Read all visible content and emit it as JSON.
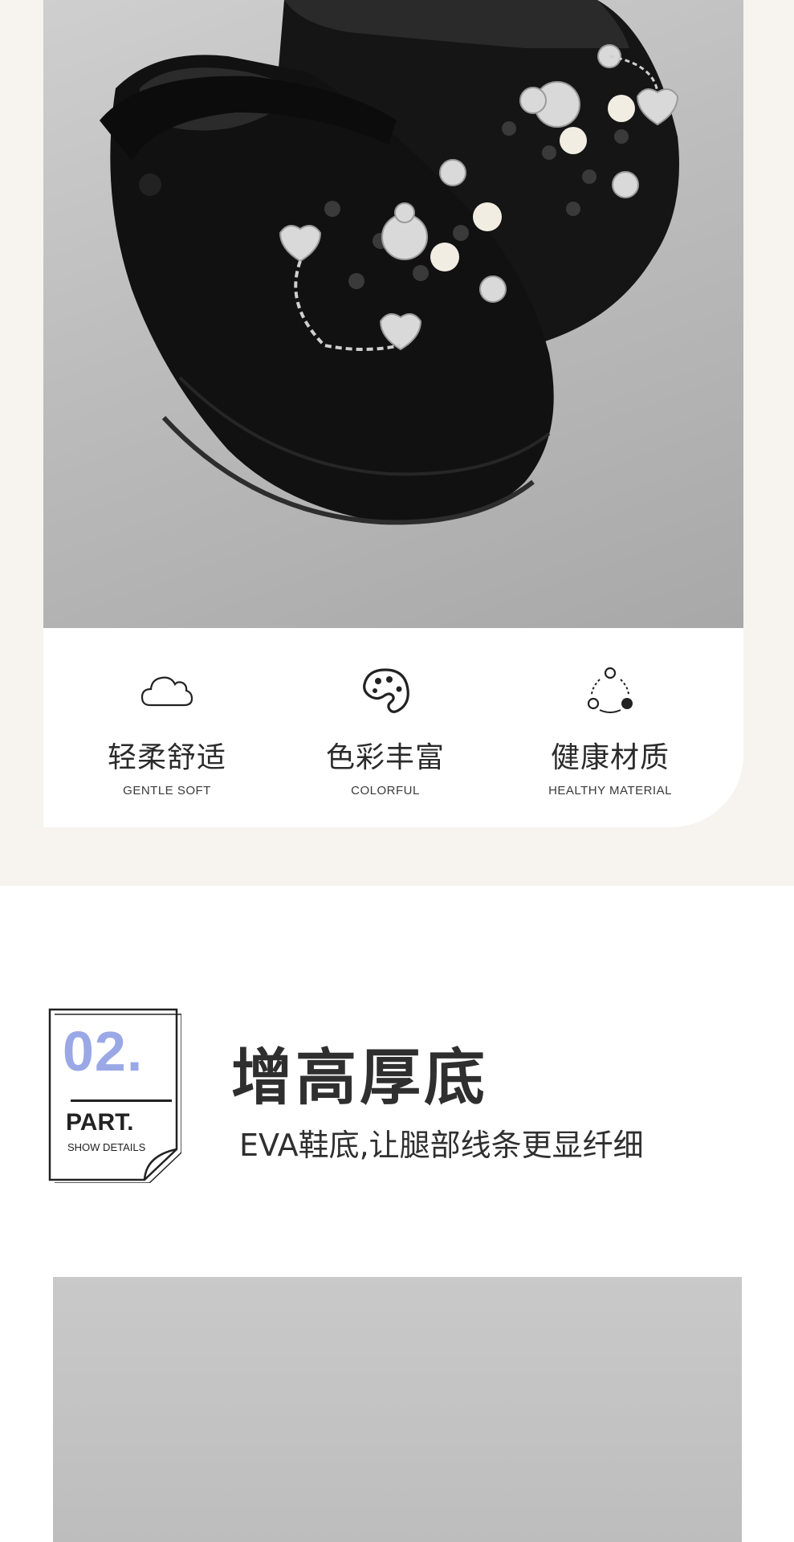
{
  "features": [
    {
      "icon": "cloud-icon",
      "title": "轻柔舒适",
      "subtitle": "GENTLE SOFT"
    },
    {
      "icon": "palette-icon",
      "title": "色彩丰富",
      "subtitle": "COLORFUL"
    },
    {
      "icon": "cycle-icon",
      "title": "健康材质",
      "subtitle": "HEALTHY MATERIAL"
    }
  ],
  "part": {
    "number": "02.",
    "label": "PART.",
    "detail": "SHOW DETAILS"
  },
  "section": {
    "title": "增高厚底",
    "subtitle": "EVA鞋底,让腿部线条更显纤细"
  },
  "colors": {
    "accent": "#9aa8e6",
    "text": "#2b2b2b",
    "page_bg": "#f7f4f0"
  }
}
